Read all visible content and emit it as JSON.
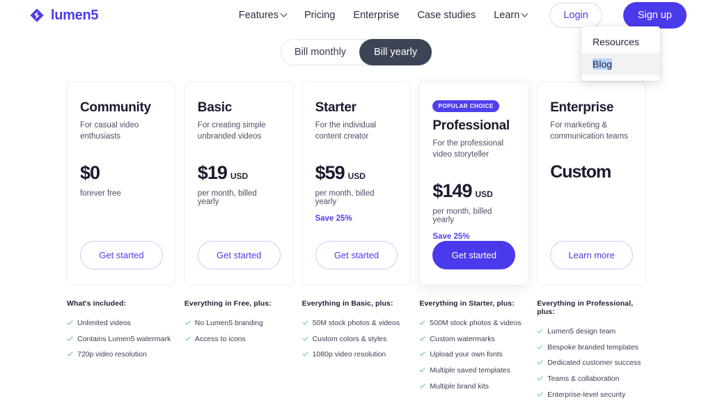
{
  "brand": {
    "name": "lumen5",
    "logo_icon": "lumen5-diamond-logo",
    "color": "#4b3ce8"
  },
  "nav": {
    "links": [
      {
        "label": "Features",
        "has_caret": true
      },
      {
        "label": "Pricing",
        "has_caret": false
      },
      {
        "label": "Enterprise",
        "has_caret": false
      },
      {
        "label": "Case studies",
        "has_caret": false
      },
      {
        "label": "Learn",
        "has_caret": true
      }
    ],
    "login_label": "Login",
    "signup_label": "Sign up"
  },
  "dropdown": {
    "open_for": "Learn",
    "items": [
      {
        "label": "Resources",
        "hovered": false,
        "text_selected": false
      },
      {
        "label": "Blog",
        "hovered": true,
        "text_selected": true
      }
    ]
  },
  "billing_toggle": {
    "options": [
      {
        "label": "Bill monthly",
        "active": false
      },
      {
        "label": "Bill yearly",
        "active": true
      }
    ],
    "active_bg": "#3c4456"
  },
  "plans": [
    {
      "badge": null,
      "title": "Community",
      "subtitle": "For casual video enthusiasts",
      "price": "$0",
      "currency": "",
      "price_note": "forever free",
      "save": "",
      "cta": "Get started",
      "cta_primary": false
    },
    {
      "badge": null,
      "title": "Basic",
      "subtitle": "For creating simple unbranded videos",
      "price": "$19",
      "currency": "USD",
      "price_note": "per month, billed yearly",
      "save": "",
      "cta": "Get started",
      "cta_primary": false
    },
    {
      "badge": null,
      "title": "Starter",
      "subtitle": "For the individual content creator",
      "price": "$59",
      "currency": "USD",
      "price_note": "per month, billed yearly",
      "save": "Save 25%",
      "cta": "Get started",
      "cta_primary": false
    },
    {
      "badge": "POPULAR CHOICE",
      "title": "Professional",
      "subtitle": "For the professional video storyteller",
      "price": "$149",
      "currency": "USD",
      "price_note": "per month, billed yearly",
      "save": "Save 25%",
      "cta": "Get started",
      "cta_primary": true
    },
    {
      "badge": null,
      "title": "Enterprise",
      "subtitle": "For marketing & communication teams",
      "price": "Custom",
      "currency": "",
      "price_note": "",
      "save": "",
      "cta": "Learn more",
      "cta_primary": false
    }
  ],
  "feature_columns": [
    {
      "heading": "What's included:",
      "items": [
        "Unlimited videos",
        "Contains Lumen5 watermark",
        "720p video resolution"
      ]
    },
    {
      "heading": "Everything in Free, plus:",
      "items": [
        "No Lumen5 branding",
        "Access to icons"
      ]
    },
    {
      "heading": "Everything in Basic, plus:",
      "items": [
        "50M stock photos & videos",
        "Custom colors & styles",
        "1080p video resolution"
      ]
    },
    {
      "heading": "Everything in Starter, plus:",
      "items": [
        "500M stock photos & videos",
        "Custom watermarks",
        "Upload your own fonts",
        "Multiple saved templates",
        "Multiple brand kits"
      ]
    },
    {
      "heading": "Everything in Professional, plus:",
      "items": [
        "Lumen5 design team",
        "Bespoke branded templates",
        "Dedicated customer success",
        "Teams & collaboration",
        "Enterprise-level security"
      ]
    }
  ],
  "colors": {
    "accent_purple": "#4a3aeb",
    "badge_purple": "#4f3fec",
    "check_green": "#54c08a",
    "toggle_dark": "#3c4456",
    "selection_blue": "#b9d5fb"
  }
}
